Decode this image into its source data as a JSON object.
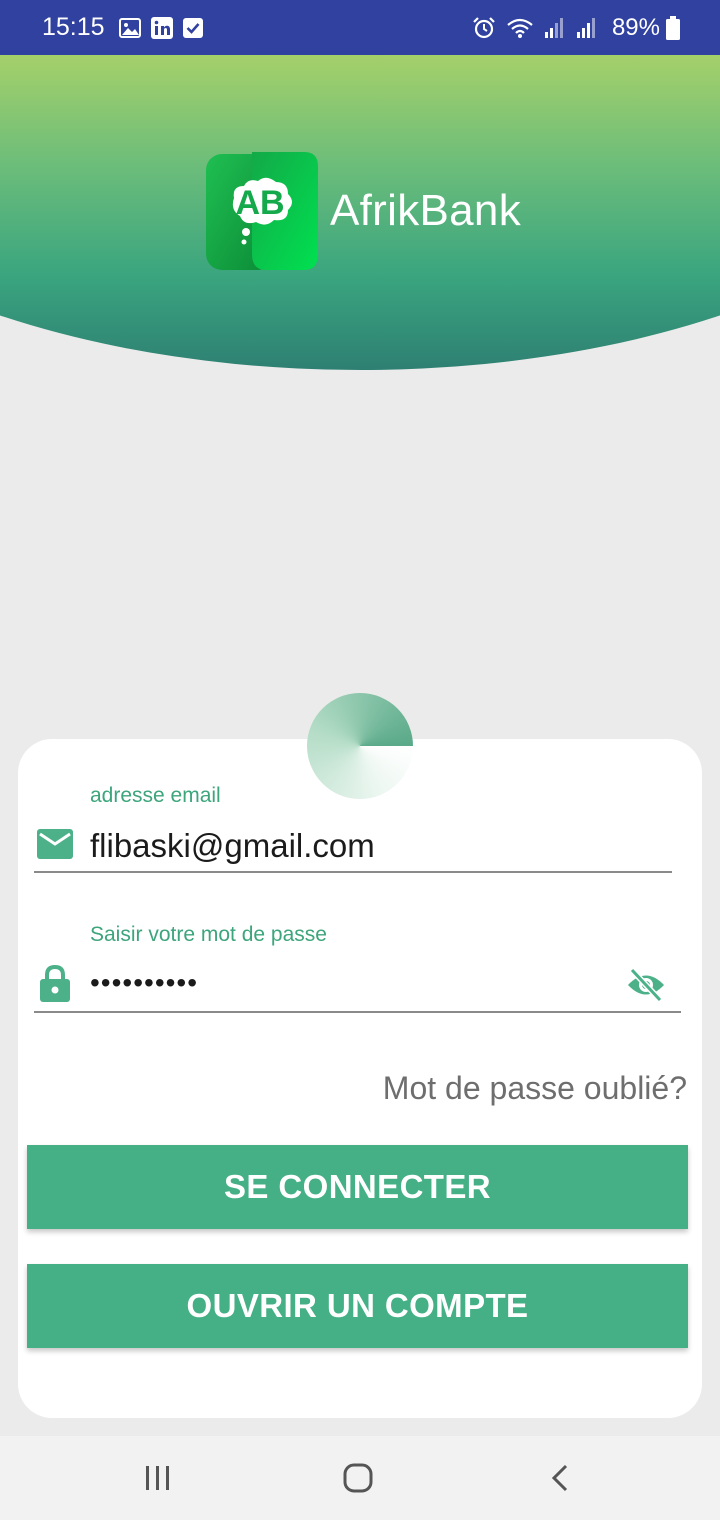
{
  "status_bar": {
    "time": "15:15",
    "battery_percent": "89%",
    "notification_icons": [
      "gallery-icon",
      "linkedin-icon",
      "checkbox-icon"
    ],
    "system_icons": [
      "alarm-icon",
      "wifi-icon",
      "signal-icon",
      "signal-icon",
      "battery-icon"
    ],
    "background": "#3041a0"
  },
  "header": {
    "app_name": "AfrikBank",
    "logo_letters": "AB",
    "colors": {
      "top": "#a5d06a",
      "bottom": "#2e8072"
    }
  },
  "login": {
    "email": {
      "label": "adresse email",
      "value": "flibaski@gmail.com",
      "icon": "mail-icon"
    },
    "password": {
      "label": "Saisir votre mot de passe",
      "value": "••••••••••",
      "icon": "lock-icon",
      "toggle_icon": "eye-off-icon"
    },
    "forgot_label": "Mot de passe oublié?",
    "login_button": "SE CONNECTER",
    "register_button": "OUVRIR UN COMPTE",
    "accent": "#45b085"
  },
  "nav_bar": {
    "buttons": [
      "recents-icon",
      "home-icon",
      "back-icon"
    ]
  }
}
